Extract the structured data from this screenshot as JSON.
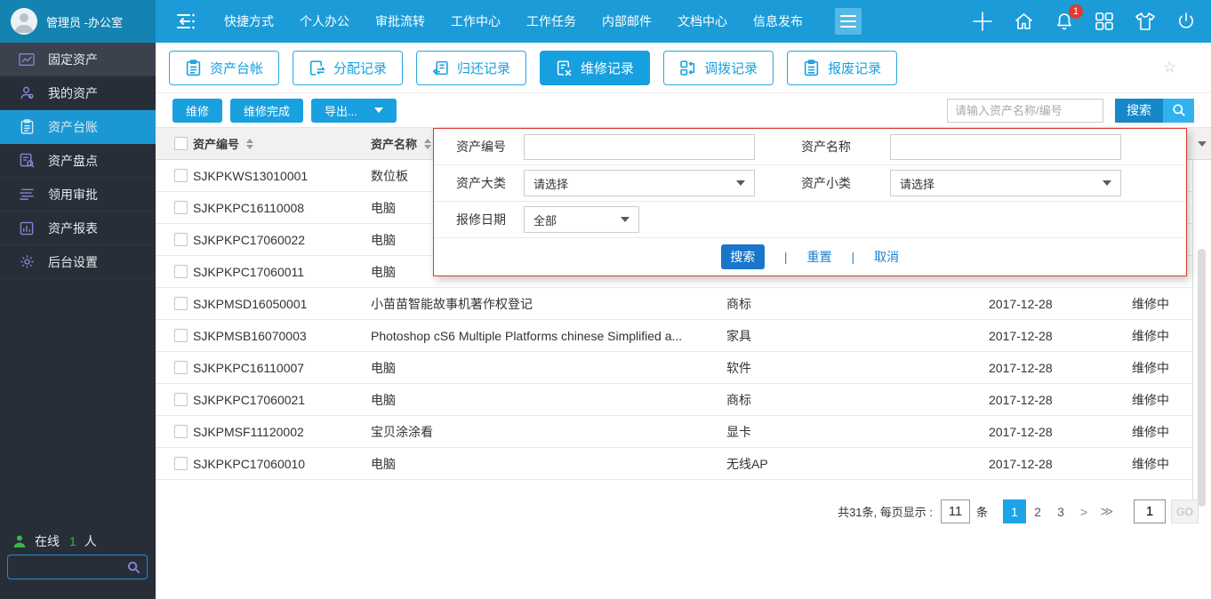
{
  "colors": {
    "topbar_blue": "#1b9cd8",
    "topbar_left_blue": "#1483b2",
    "accent_blue": "#19a0df",
    "panel_border_red": "#d43c33",
    "badge_red": "#e23b2e",
    "online_green": "#3db54b",
    "active_page_blue": "#1ca3e8"
  },
  "topbar": {
    "user": "管理员 -办公室",
    "menu": [
      "快捷方式",
      "个人办公",
      "审批流转",
      "工作中心",
      "工作任务",
      "内部邮件",
      "文档中心",
      "信息发布"
    ],
    "badge": "1"
  },
  "sidebar": {
    "items": [
      {
        "label": "固定资产"
      },
      {
        "label": "我的资产"
      },
      {
        "label": "资产台账"
      },
      {
        "label": "资产盘点"
      },
      {
        "label": "领用审批"
      },
      {
        "label": "资产报表"
      },
      {
        "label": "后台设置"
      }
    ],
    "online_label": "在线",
    "online_count": "1",
    "online_suffix": "人"
  },
  "tabs": [
    {
      "label": "资产台帐"
    },
    {
      "label": "分配记录"
    },
    {
      "label": "归还记录"
    },
    {
      "label": "维修记录"
    },
    {
      "label": "调拨记录"
    },
    {
      "label": "报废记录"
    }
  ],
  "toolbar": {
    "repair": "维修",
    "repair_done": "维修完成",
    "export": "导出...",
    "search_placeholder": "请输入资产名称/编号",
    "search_label": "搜索"
  },
  "table": {
    "header_no": "资产编号",
    "header_name": "资产名称",
    "rows": [
      {
        "no": "SJKPKWS13010001",
        "name": "数位板",
        "category": "",
        "date": "",
        "status": ""
      },
      {
        "no": "SJKPKPC16110008",
        "name": "电脑",
        "category": "",
        "date": "",
        "status": ""
      },
      {
        "no": "SJKPKPC17060022",
        "name": "电脑",
        "category": "",
        "date": "",
        "status": ""
      },
      {
        "no": "SJKPKPC17060011",
        "name": "电脑",
        "category": "",
        "date": "",
        "status": ""
      },
      {
        "no": "SJKPMSD16050001",
        "name": "小苗苗智能故事机著作权登记",
        "category": "商标",
        "date": "2017-12-28",
        "status": "维修中"
      },
      {
        "no": "SJKPMSB16070003",
        "name": "Photoshop cS6 Multiple Platforms chinese Simplified a...",
        "category": "家具",
        "date": "2017-12-28",
        "status": "维修中"
      },
      {
        "no": "SJKPKPC16110007",
        "name": "电脑",
        "category": "软件",
        "date": "2017-12-28",
        "status": "维修中"
      },
      {
        "no": "SJKPKPC17060021",
        "name": "电脑",
        "category": "商标",
        "date": "2017-12-28",
        "status": "维修中"
      },
      {
        "no": "SJKPMSF11120002",
        "name": "宝贝涂涂看",
        "category": "显卡",
        "date": "2017-12-28",
        "status": "维修中"
      },
      {
        "no": "SJKPKPC17060010",
        "name": "电脑",
        "category": "无线AP",
        "date": "2017-12-28",
        "status": "维修中"
      }
    ]
  },
  "panel": {
    "asset_no_label": "资产编号",
    "asset_name_label": "资产名称",
    "category_label": "资产大类",
    "subcategory_label": "资产小类",
    "date_label": "报修日期",
    "select_placeholder": "请选择",
    "date_value": "全部",
    "search_label": "搜索",
    "reset_label": "重置",
    "cancel_label": "取消",
    "separator": "|"
  },
  "pagination": {
    "total_text": "共31条, 每页显示 :",
    "page_size": "11",
    "unit": "条",
    "pages": [
      "1",
      "2",
      "3",
      ">",
      "≫"
    ],
    "jump_value": "1",
    "go_label": "GO"
  }
}
